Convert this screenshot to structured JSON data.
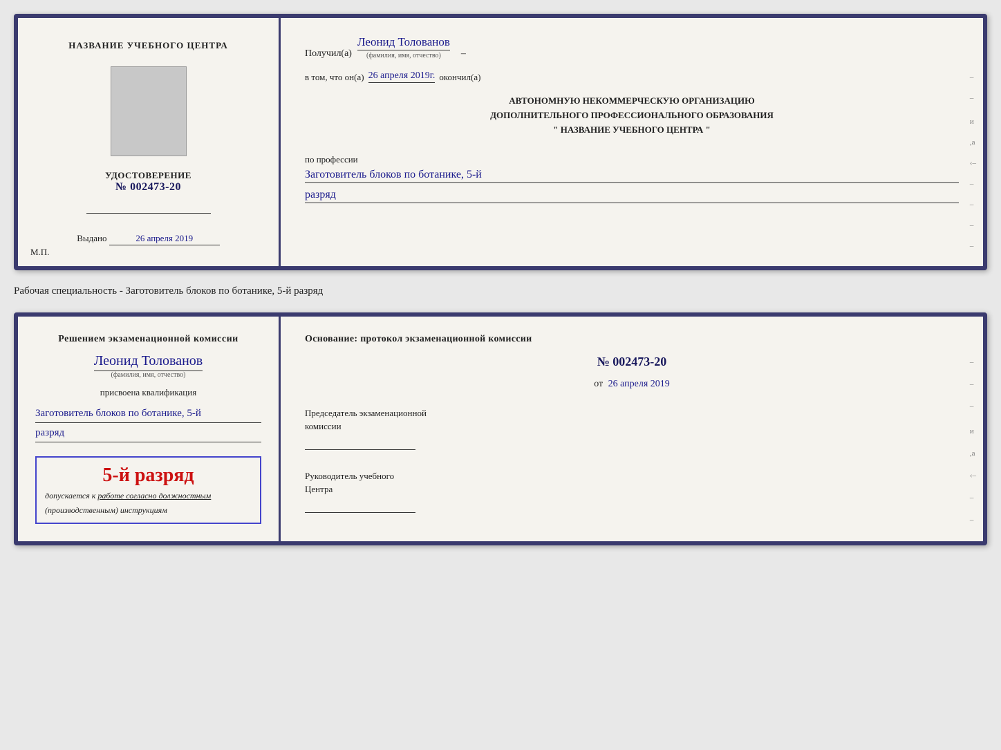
{
  "doc1": {
    "left": {
      "title": "НАЗВАНИЕ УЧЕБНОГО ЦЕНТРА",
      "cert_label": "УДОСТОВЕРЕНИЕ",
      "cert_number": "№ 002473-20",
      "issued_label": "Выдано",
      "issued_date": "26 апреля 2019",
      "mp_label": "М.П."
    },
    "right": {
      "received_prefix": "Получил(а)",
      "recipient_name": "Леонид Толованов",
      "fio_label": "(фамилия, имя, отчество)",
      "dash": "–",
      "certify_prefix": "в том, что он(а)",
      "certify_date": "26 апреля 2019г.",
      "certify_suffix": "окончил(а)",
      "org_line1": "АВТОНОМНУЮ НЕКОММЕРЧЕСКУЮ ОРГАНИЗАЦИЮ",
      "org_line2": "ДОПОЛНИТЕЛЬНОГО ПРОФЕССИОНАЛЬНОГО ОБРАЗОВАНИЯ",
      "org_line3": "\"  НАЗВАНИЕ УЧЕБНОГО ЦЕНТРА  \"",
      "profession_prefix": "по профессии",
      "profession_value": "Заготовитель блоков по ботанике, 5-й",
      "razryad_value": "разряд"
    }
  },
  "specialty_label": "Рабочая специальность - Заготовитель блоков по ботанике, 5-й разряд",
  "doc2": {
    "left": {
      "decision_text": "Решением экзаменационной комиссии",
      "name": "Леонид Толованов",
      "fio_label": "(фамилия, имя, отчество)",
      "assigned_text": "присвоена квалификация",
      "qualification_line1": "Заготовитель блоков по ботанике, 5-й",
      "qualification_line2": "разряд",
      "stamp_main": "5-й разряд",
      "stamp_sub_prefix": "допускается к",
      "stamp_sub_underline": "работе согласно должностным",
      "stamp_sub_italic": "(производственным) инструкциям"
    },
    "right": {
      "basis_text": "Основание: протокол экзаменационной комиссии",
      "protocol_number": "№  002473-20",
      "from_label": "от",
      "from_date": "26 апреля 2019",
      "chairman_label": "Председатель экзаменационной",
      "chairman_label2": "комиссии",
      "head_label": "Руководитель учебного",
      "head_label2": "Центра"
    }
  }
}
